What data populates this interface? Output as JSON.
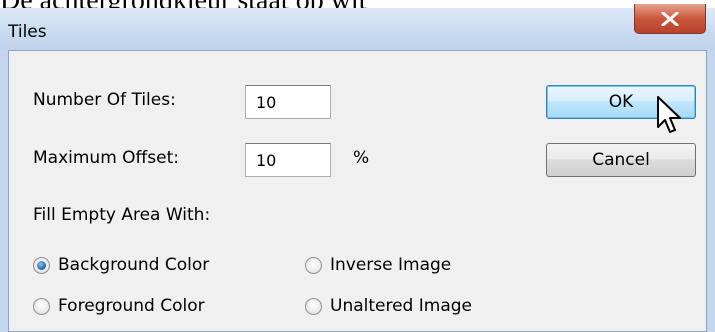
{
  "document": {
    "partial_text": "De achtergrondkleur staat op wit"
  },
  "window": {
    "title": "Tiles"
  },
  "close_button": {
    "glyph": "X"
  },
  "fields": {
    "number_of_tiles": {
      "label": "Number Of Tiles:",
      "value": "10"
    },
    "maximum_offset": {
      "label": "Maximum Offset:",
      "value": "10",
      "unit": "%"
    }
  },
  "buttons": {
    "ok": "OK",
    "cancel": "Cancel"
  },
  "fill_group": {
    "label": "Fill Empty Area With:",
    "options": [
      {
        "label": "Background Color",
        "checked": true
      },
      {
        "label": "Inverse Image",
        "checked": false
      },
      {
        "label": "Foreground Color",
        "checked": false
      },
      {
        "label": "Unaltered Image",
        "checked": false
      }
    ]
  },
  "colors": {
    "ok_accent": "#3c7fb1",
    "radio_selected": "#1c5fa0",
    "close_red": "#c9573a"
  },
  "icons": {
    "cursor": "arrow-pointer-icon"
  }
}
